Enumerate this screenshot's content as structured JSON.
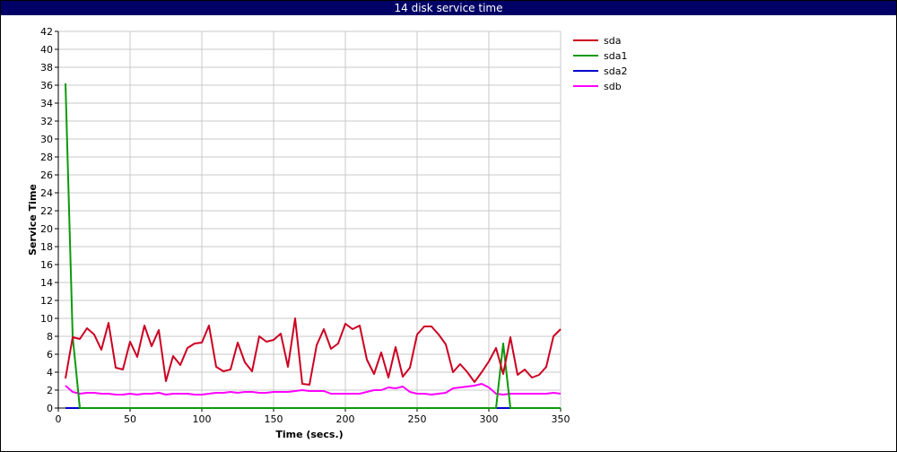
{
  "window": {
    "title": "14 disk service time"
  },
  "chart_data": {
    "type": "line",
    "title": "14 disk service time",
    "xlabel": "Time (secs.)",
    "ylabel": "Service Time",
    "xlim": [
      0,
      350
    ],
    "ylim": [
      0,
      42
    ],
    "xticks": [
      0,
      50,
      100,
      150,
      200,
      250,
      300,
      350
    ],
    "yticks": [
      0,
      2,
      4,
      6,
      8,
      10,
      12,
      14,
      16,
      18,
      20,
      22,
      24,
      26,
      28,
      30,
      32,
      34,
      36,
      38,
      40,
      42
    ],
    "grid": true,
    "legend_position": "right",
    "series": [
      {
        "name": "sda",
        "color": "#cc0022",
        "x": [
          5,
          10,
          15,
          20,
          25,
          30,
          35,
          40,
          45,
          50,
          55,
          60,
          65,
          70,
          75,
          80,
          85,
          90,
          95,
          100,
          105,
          110,
          115,
          120,
          125,
          130,
          135,
          140,
          145,
          150,
          155,
          160,
          165,
          170,
          175,
          180,
          185,
          190,
          195,
          200,
          205,
          210,
          215,
          220,
          225,
          230,
          235,
          240,
          245,
          250,
          255,
          260,
          265,
          270,
          275,
          280,
          285,
          290,
          295,
          300,
          305,
          310,
          315,
          320,
          325,
          330,
          335,
          340,
          345,
          350
        ],
        "y": [
          3.3,
          7.9,
          7.7,
          8.9,
          8.2,
          6.5,
          9.5,
          4.5,
          4.3,
          7.4,
          5.7,
          9.2,
          6.9,
          8.7,
          3.0,
          5.8,
          4.8,
          6.7,
          7.2,
          7.3,
          9.2,
          4.6,
          4.1,
          4.3,
          7.3,
          5.1,
          4.1,
          8.0,
          7.4,
          7.6,
          8.3,
          4.6,
          10.0,
          2.7,
          2.6,
          7.0,
          8.8,
          6.6,
          7.2,
          9.4,
          8.8,
          9.2,
          5.4,
          3.8,
          6.2,
          3.4,
          6.8,
          3.5,
          4.5,
          8.2,
          9.1,
          9.1,
          8.2,
          7.1,
          4.0,
          4.9,
          4.0,
          2.9,
          4.0,
          5.2,
          6.7,
          3.8,
          7.9,
          3.7,
          4.3,
          3.4,
          3.7,
          4.6,
          8.0,
          8.8
        ]
      },
      {
        "name": "sda1",
        "color": "#0b9a0b",
        "x": [
          5,
          10,
          15,
          20,
          300,
          305,
          310,
          315,
          320,
          350
        ],
        "y": [
          36.2,
          8.0,
          0,
          0,
          0,
          0,
          7.2,
          0,
          0,
          0
        ]
      },
      {
        "name": "sda2",
        "color": "#0000cc",
        "x": [
          5,
          350
        ],
        "y": [
          0,
          0
        ]
      },
      {
        "name": "sdb",
        "color": "#ff00ff",
        "x": [
          5,
          10,
          15,
          20,
          25,
          30,
          35,
          40,
          45,
          50,
          55,
          60,
          65,
          70,
          75,
          80,
          85,
          90,
          95,
          100,
          105,
          110,
          115,
          120,
          125,
          130,
          135,
          140,
          145,
          150,
          155,
          160,
          165,
          170,
          175,
          180,
          185,
          190,
          195,
          200,
          205,
          210,
          215,
          220,
          225,
          230,
          235,
          240,
          245,
          250,
          255,
          260,
          265,
          270,
          275,
          280,
          285,
          290,
          295,
          300,
          305,
          310,
          315,
          320,
          325,
          330,
          335,
          340,
          345,
          350
        ],
        "y": [
          2.5,
          1.8,
          1.6,
          1.7,
          1.7,
          1.6,
          1.6,
          1.5,
          1.5,
          1.6,
          1.5,
          1.6,
          1.6,
          1.7,
          1.5,
          1.6,
          1.6,
          1.6,
          1.5,
          1.5,
          1.6,
          1.7,
          1.7,
          1.8,
          1.7,
          1.8,
          1.8,
          1.7,
          1.7,
          1.8,
          1.8,
          1.8,
          1.9,
          2.0,
          1.9,
          1.9,
          1.9,
          1.6,
          1.6,
          1.6,
          1.6,
          1.6,
          1.8,
          2.0,
          2.0,
          2.3,
          2.2,
          2.4,
          1.8,
          1.6,
          1.6,
          1.5,
          1.6,
          1.7,
          2.2,
          2.3,
          2.4,
          2.5,
          2.7,
          2.3,
          1.6,
          1.5,
          1.6,
          1.6,
          1.6,
          1.6,
          1.6,
          1.6,
          1.7,
          1.6
        ]
      }
    ]
  }
}
